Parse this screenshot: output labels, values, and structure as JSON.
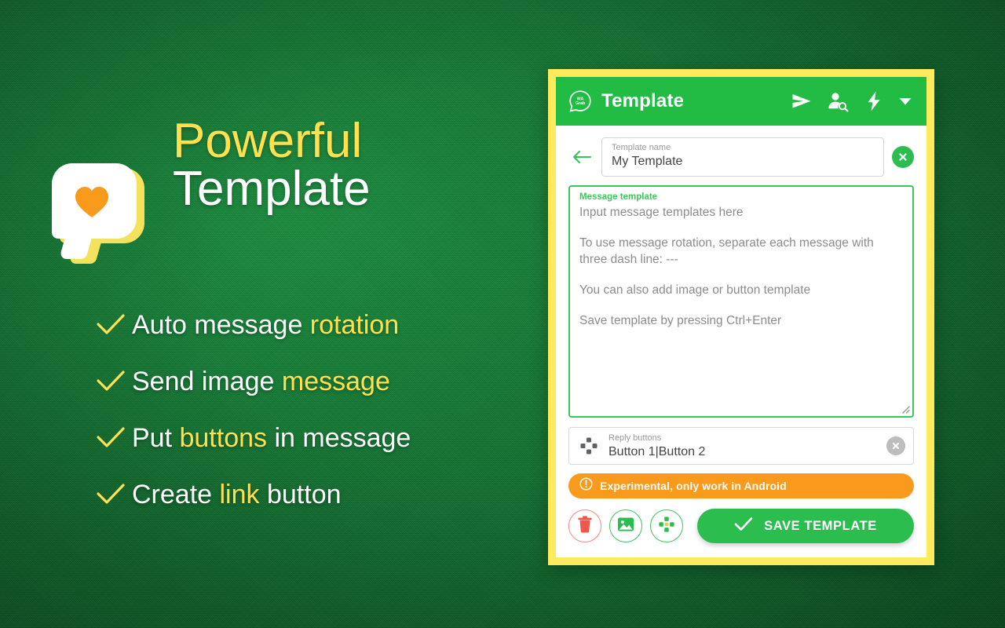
{
  "promo": {
    "headline_line1": "Powerful",
    "headline_line2": "Template",
    "logo_icon": "heart-speech-bubble-icon",
    "features": [
      {
        "check_icon": "check-icon",
        "prefix": "Auto message ",
        "highlight": "rotation",
        "suffix": ""
      },
      {
        "check_icon": "check-icon",
        "prefix": "Send image ",
        "highlight": "message",
        "suffix": ""
      },
      {
        "check_icon": "check-icon",
        "prefix": "Put ",
        "highlight": "buttons",
        "suffix": " in message"
      },
      {
        "check_icon": "check-icon",
        "prefix": "Create ",
        "highlight": "link",
        "suffix": " button"
      }
    ]
  },
  "app": {
    "header": {
      "logo_icon": "wa-grab-bubble-logo-icon",
      "logo_text": "WA Grab",
      "title": "Template",
      "actions": [
        {
          "icon": "send-icon",
          "label": "Send"
        },
        {
          "icon": "person-search-icon",
          "label": "Find contact"
        },
        {
          "icon": "lightning-bolt-icon",
          "label": "Quick action"
        }
      ],
      "caret_icon": "chevron-down-icon"
    },
    "name_row": {
      "back_icon": "arrow-left-icon",
      "field_label": "Template name",
      "field_value": "My Template",
      "clear_icon": "close-circle-icon"
    },
    "message_box": {
      "label": "Message template",
      "paragraphs": [
        "Input message templates here",
        "To use message rotation, separate each message with three dash line: ---",
        "You can also add image or button template",
        "Save template by pressing Ctrl+Enter"
      ],
      "resize_icon": "resize-grip-icon"
    },
    "reply_row": {
      "icon": "dpad-buttons-icon",
      "label": "Reply buttons",
      "value": "Button 1|Button 2",
      "clear_icon": "close-circle-icon"
    },
    "warning": {
      "icon": "exclamation-circle-icon",
      "text": "Experimental, only work in Android"
    },
    "actions": {
      "delete_icon": "trash-icon",
      "image_icon": "image-icon",
      "buttons_icon": "dpad-buttons-icon",
      "save_check_icon": "check-icon",
      "save_label": "SAVE TEMPLATE"
    }
  },
  "colors": {
    "background_green": "#0c6b2b",
    "frame_yellow": "#ffe95c",
    "header_green": "#22bb44",
    "accent_green": "#2bbd4e",
    "highlight_yellow": "#ffe14f",
    "warning_orange": "#f99a1c",
    "danger_red": "#f4867f",
    "heart_orange": "#f89b1c"
  }
}
